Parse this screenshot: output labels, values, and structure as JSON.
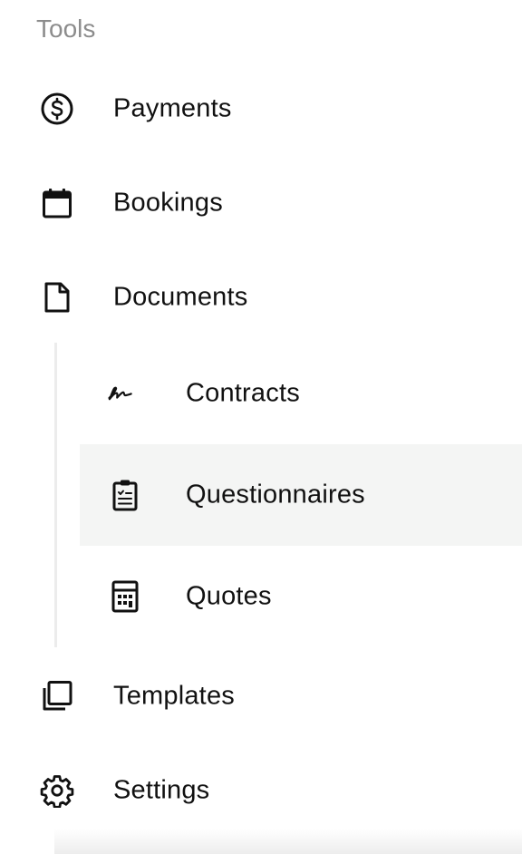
{
  "sidebar": {
    "section_title": "Tools",
    "items": [
      {
        "label": "Payments",
        "icon": "dollar-circle-icon"
      },
      {
        "label": "Bookings",
        "icon": "calendar-icon"
      },
      {
        "label": "Documents",
        "icon": "document-icon"
      },
      {
        "label": "Templates",
        "icon": "copy-icon"
      },
      {
        "label": "Settings",
        "icon": "gear-icon"
      }
    ],
    "documents_sub_items": [
      {
        "label": "Contracts",
        "icon": "signature-icon"
      },
      {
        "label": "Questionnaires",
        "icon": "clipboard-checklist-icon",
        "active": true
      },
      {
        "label": "Quotes",
        "icon": "calculator-icon"
      }
    ]
  },
  "colors": {
    "text": "#111111",
    "heading": "#8c8c8c",
    "active_background": "#f4f5f4",
    "rail": "#ececec"
  }
}
